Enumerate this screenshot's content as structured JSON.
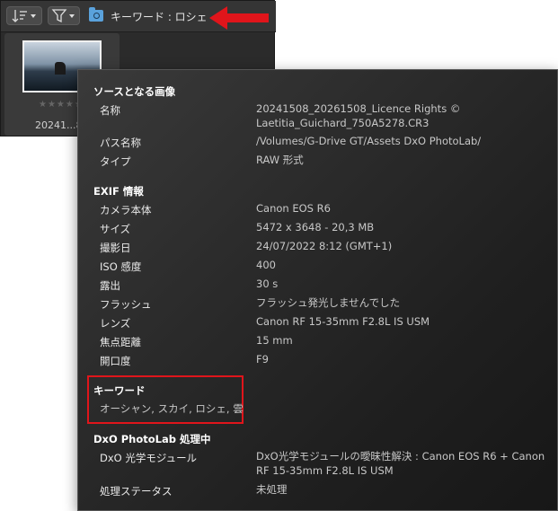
{
  "browser": {
    "breadcrumb": "キーワード : ロシェ",
    "thumbnail": {
      "stars": "★★★★★",
      "caption": "20241...8.C"
    }
  },
  "panel": {
    "source": {
      "title": "ソースとなる画像",
      "rows": [
        {
          "label": "名称",
          "value1": "20241508_20261508_Licence Rights ©",
          "value2": "Laetitia_Guichard_750A5278.CR3"
        },
        {
          "label": "パス名称",
          "value": "/Volumes/G-Drive GT/Assets DxO PhotoLab/"
        },
        {
          "label": "タイプ",
          "value": "RAW 形式"
        }
      ]
    },
    "exif": {
      "title": "EXIF 情報",
      "rows": [
        {
          "label": "カメラ本体",
          "value": "Canon EOS R6"
        },
        {
          "label": "サイズ",
          "value": "5472 x 3648 - 20,3 MB"
        },
        {
          "label": "撮影日",
          "value": "24/07/2022 8:12 (GMT+1)"
        },
        {
          "label": "ISO 感度",
          "value": "400"
        },
        {
          "label": "露出",
          "value": "30 s"
        },
        {
          "label": "フラッシュ",
          "value": "フラッシュ発光しませんでした"
        },
        {
          "label": "レンズ",
          "value": "Canon RF 15-35mm F2.8L IS USM"
        },
        {
          "label": "焦点距離",
          "value": "15 mm"
        },
        {
          "label": "開口度",
          "value": "F9"
        }
      ]
    },
    "keywords": {
      "title": "キーワード",
      "value": "オーシャン, スカイ, ロシェ, 雲"
    },
    "dxo": {
      "title": "DxO PhotoLab 処理中",
      "rows": [
        {
          "label": "DxO 光学モジュール",
          "value1": "DxO光学モジュールの曖昧性解決 : Canon EOS R6 + Canon",
          "value2": "RF 15-35mm F2.8L IS USM"
        },
        {
          "label": "処理ステータス",
          "value": "未処理"
        }
      ]
    }
  },
  "colors": {
    "highlight": "#e0151b",
    "folder": "#5aa2dc"
  }
}
